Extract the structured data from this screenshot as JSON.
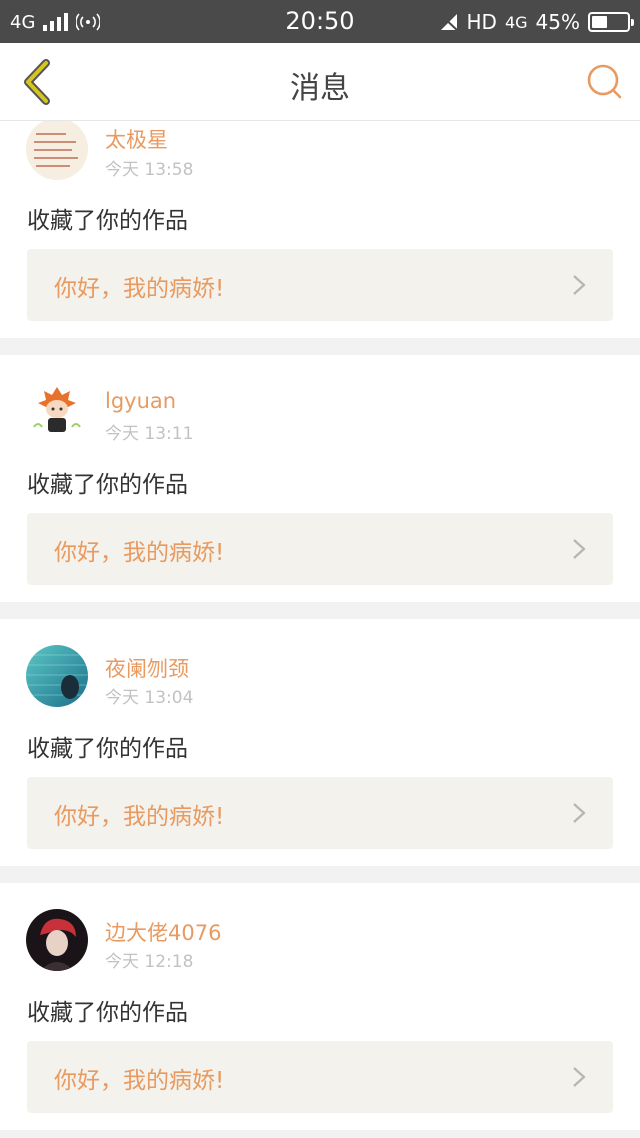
{
  "status_bar": {
    "network": "4G",
    "time": "20:50",
    "hd": "HD",
    "network2": "4G",
    "battery_percent": "45%",
    "battery_level": 0.45
  },
  "nav": {
    "title": "消息",
    "back_icon": "chevron-left-icon",
    "search_icon": "search-icon",
    "accent_color": "#e89a60",
    "back_color": "#d6c51e"
  },
  "messages": [
    {
      "user": "太极星",
      "time": "今天 13:58",
      "action": "收藏了你的作品",
      "work_title": "你好，我的病娇!"
    },
    {
      "user": "lgyuan",
      "time": "今天 13:11",
      "action": "收藏了你的作品",
      "work_title": "你好，我的病娇!"
    },
    {
      "user": "夜阑刎颈",
      "time": "今天 13:04",
      "action": "收藏了你的作品",
      "work_title": "你好，我的病娇!"
    },
    {
      "user": "边大佬4076",
      "time": "今天 12:18",
      "action": "收藏了你的作品",
      "work_title": "你好，我的病娇!"
    }
  ]
}
